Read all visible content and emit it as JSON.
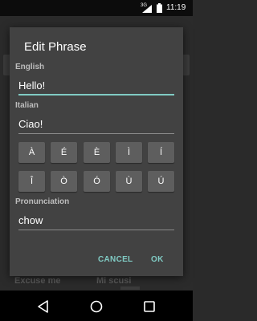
{
  "status_bar": {
    "network": "3G",
    "time": "11:19",
    "icons": [
      "signal-icon",
      "battery-icon"
    ]
  },
  "background": {
    "row_left": "Excuse me",
    "row_right": "Mi scusi"
  },
  "dialog": {
    "title": "Edit Phrase",
    "english_label": "English",
    "english_value": "Hello!",
    "italian_label": "Italian",
    "italian_value": "Ciao!",
    "accent_keys": [
      "À",
      "É",
      "È",
      "Ì",
      "Í",
      "Î",
      "Ò",
      "Ó",
      "Ù",
      "Ú"
    ],
    "pronunciation_label": "Pronunciation",
    "pronunciation_value": "chow",
    "cancel_label": "CANCEL",
    "ok_label": "OK"
  },
  "nav_bar": {
    "icons": [
      "back-icon",
      "home-icon",
      "recents-icon"
    ]
  },
  "colors": {
    "accent": "#80cbc4",
    "dialog_bg": "#424242",
    "key_bg": "#5e5e5e"
  }
}
